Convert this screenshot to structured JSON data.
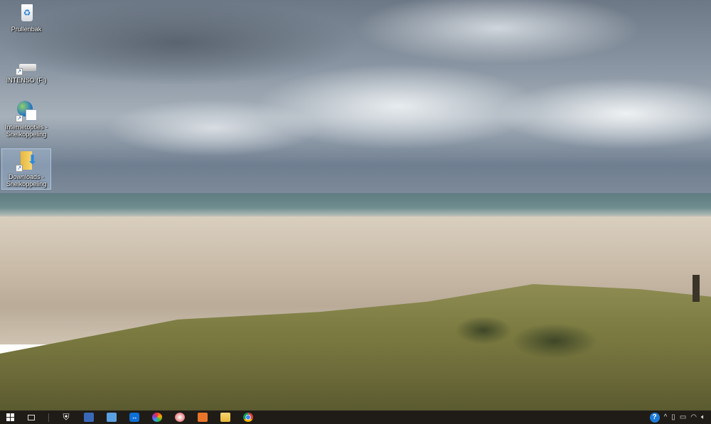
{
  "desktop": {
    "icons": [
      {
        "label": "Prullenbak",
        "icon": "recycle-bin-icon"
      },
      {
        "label": "INTENSO (F:)",
        "icon": "drive-icon"
      },
      {
        "label": "Internetopties - Snelkoppeling",
        "icon": "internet-options-icon"
      },
      {
        "label": "Downloads - Snelkoppeling",
        "icon": "downloads-folder-icon",
        "selected": true
      }
    ]
  },
  "taskbar": {
    "items": [
      "start-icon",
      "task-view-icon",
      "windows-defender-icon",
      "word-icon",
      "control-panel-icon",
      "teamviewer-icon",
      "picasa-icon",
      "paint-icon",
      "media-player-icon",
      "file-explorer-icon",
      "chrome-icon"
    ],
    "tray": [
      "help-icon",
      "chevron-up-icon",
      "usb-icon",
      "battery-icon",
      "wifi-icon",
      "volume-icon"
    ],
    "tray_help": "?"
  },
  "colors": {
    "taskbar": "#1f1c17",
    "selection": "#b4cdeb"
  }
}
